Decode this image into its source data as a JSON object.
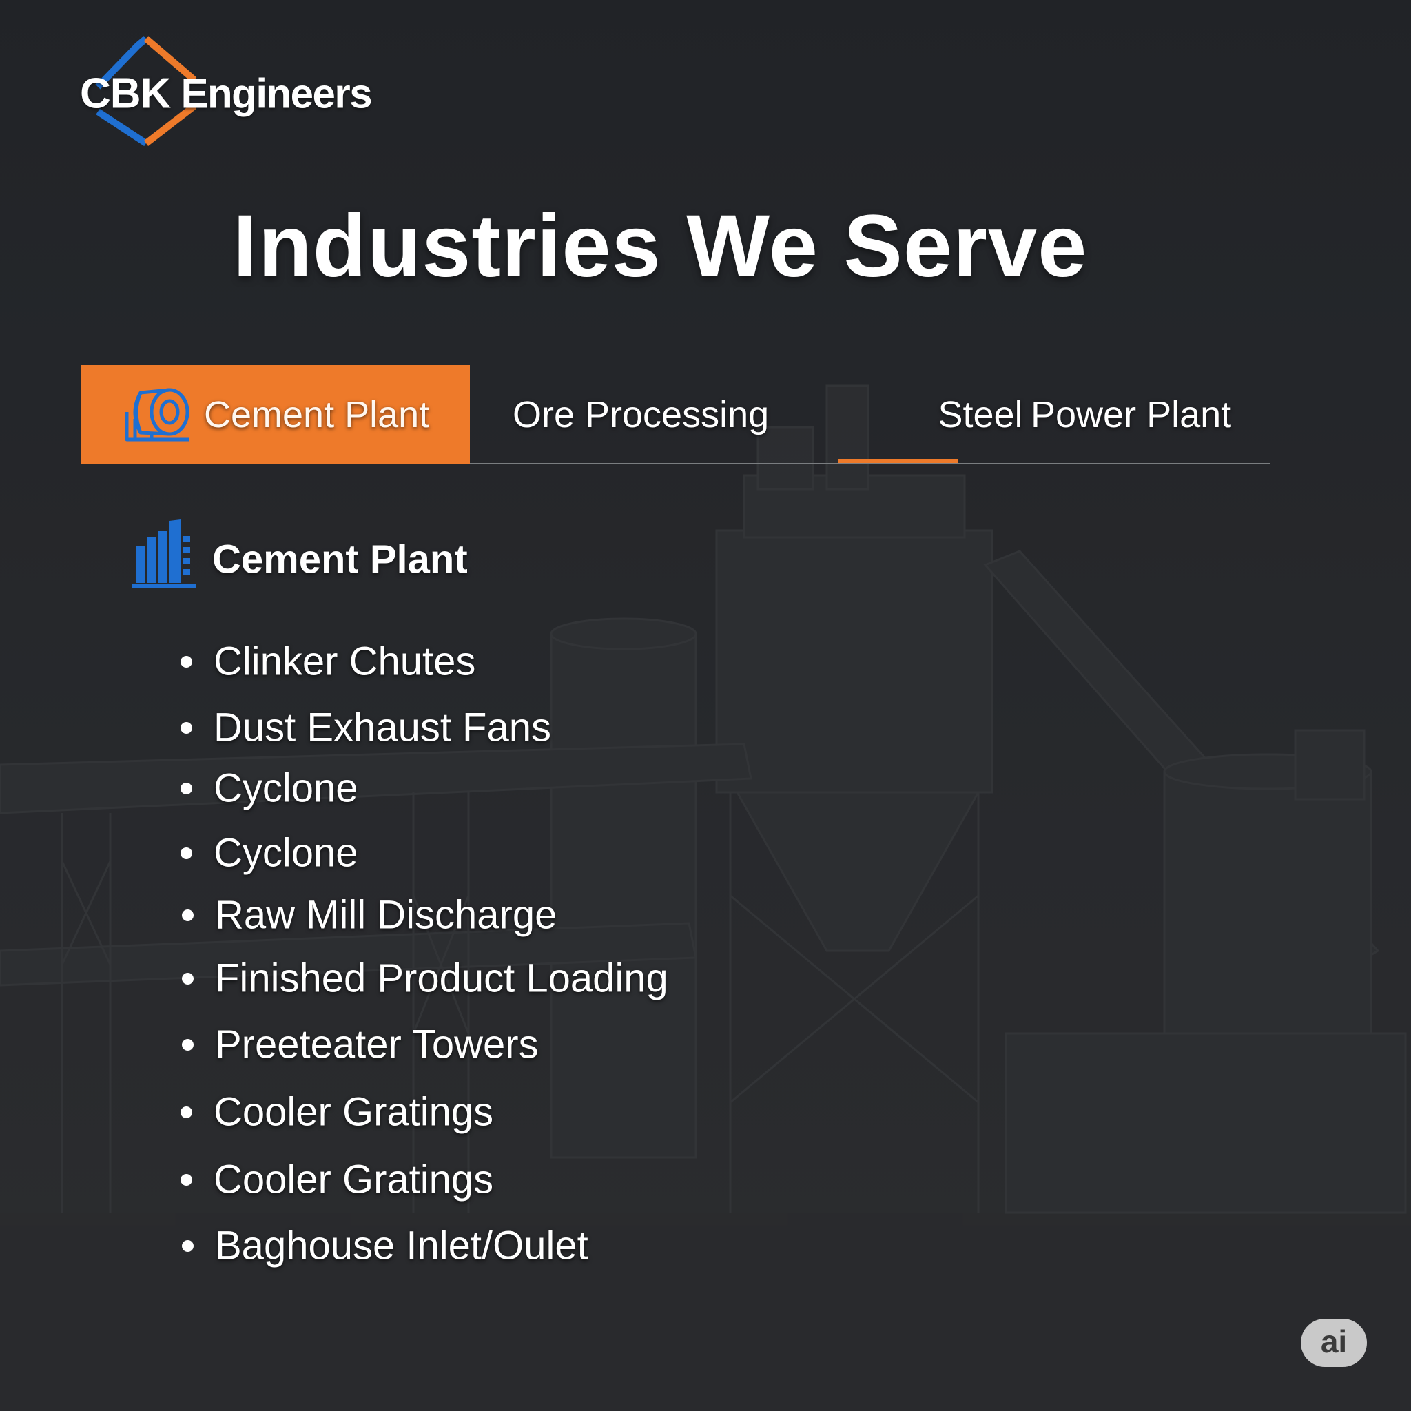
{
  "brand": {
    "name_prefix": "CBK",
    "name_suffix": " Engineers",
    "logo_colors": {
      "orange": "#ee7a2a",
      "blue": "#1f6fd1"
    }
  },
  "page_title": "Industries We Serve",
  "tabs": [
    {
      "label": "Cement Plant",
      "active": true,
      "icon": "kiln-icon"
    },
    {
      "label": "Ore Processing",
      "active": false
    },
    {
      "label": "Steel",
      "active": false,
      "underlined": true
    },
    {
      "label": "Power Plant",
      "active": false
    }
  ],
  "section": {
    "title": "Cement Plant",
    "icon": "factory-building-icon",
    "items": [
      "Clinker Chutes",
      "Dust Exhaust Fans",
      "Cyclone",
      "Cyclone",
      "Raw Mill Discharge",
      "Finished Product Loading",
      "Preeteater Towers",
      "Cooler Gratings",
      "Cooler Gratings",
      "Baghouse Inlet/Oulet"
    ]
  },
  "badge": {
    "label": "ai"
  },
  "colors": {
    "background": "#24272b",
    "accent": "#ee7a2a",
    "icon_blue": "#1f6fd1",
    "text": "#ffffff"
  }
}
